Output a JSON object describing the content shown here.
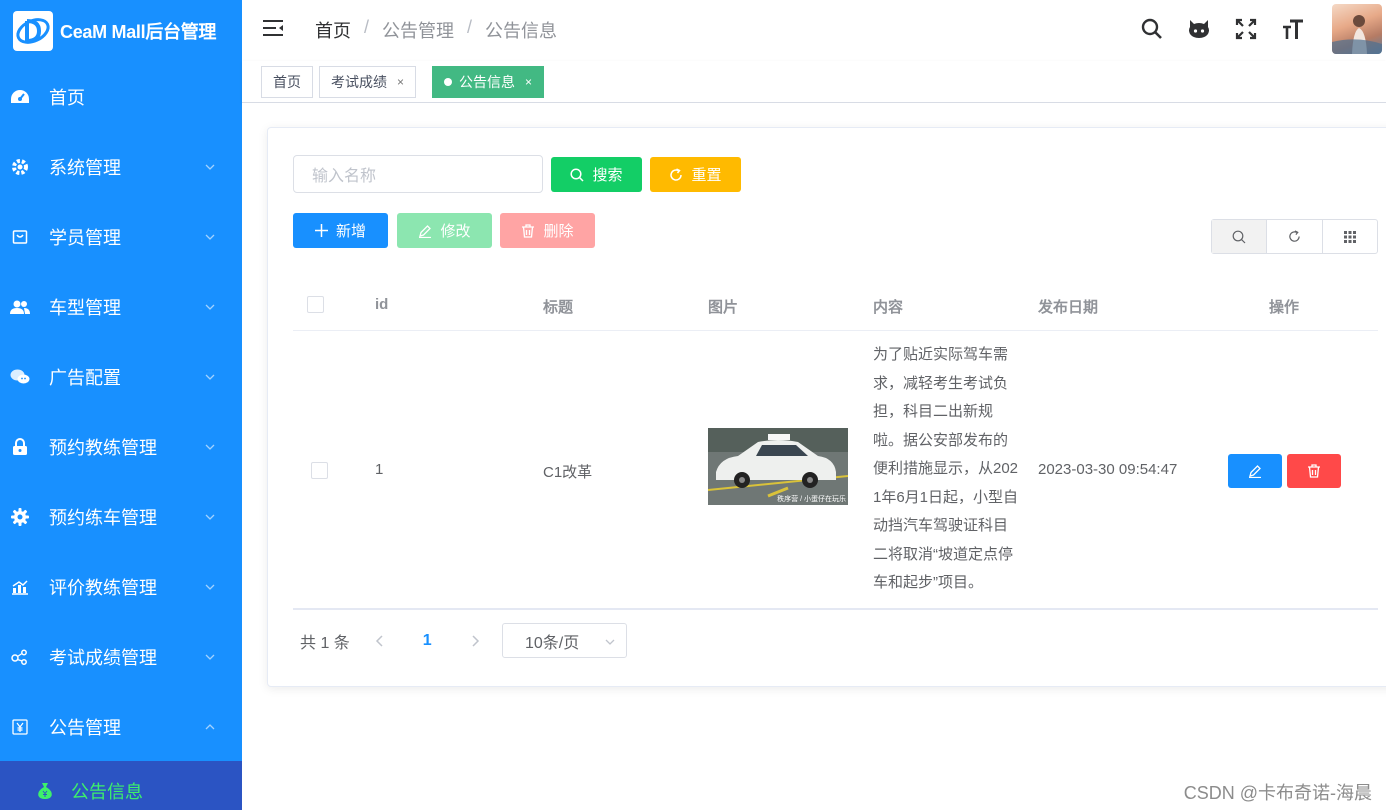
{
  "app": {
    "title": "CeaM Mall后台管理"
  },
  "sidebar": {
    "items": [
      {
        "label": "首页",
        "icon": "dashboard-icon"
      },
      {
        "label": "系统管理",
        "icon": "gear-icon"
      },
      {
        "label": "学员管理",
        "icon": "shopping-icon"
      },
      {
        "label": "车型管理",
        "icon": "users-icon"
      },
      {
        "label": "广告配置",
        "icon": "wechat-icon"
      },
      {
        "label": "预约教练管理",
        "icon": "lock-icon"
      },
      {
        "label": "预约练车管理",
        "icon": "cog-icon"
      },
      {
        "label": "评价教练管理",
        "icon": "chart-icon"
      },
      {
        "label": "考试成绩管理",
        "icon": "share-icon"
      },
      {
        "label": "公告管理",
        "icon": "yen-icon"
      }
    ],
    "sub_active": {
      "label": "公告信息",
      "icon": "money-bag-icon"
    }
  },
  "header": {
    "breadcrumb": [
      "首页",
      "公告管理",
      "公告信息"
    ]
  },
  "tags": [
    {
      "label": "首页"
    },
    {
      "label": "考试成绩"
    },
    {
      "label": "公告信息"
    }
  ],
  "tag_close": "×",
  "search": {
    "placeholder": "输入名称",
    "search_label": "搜索",
    "reset_label": "重置"
  },
  "actions": {
    "add": "新增",
    "edit": "修改",
    "delete": "删除"
  },
  "table": {
    "columns": [
      "id",
      "标题",
      "图片",
      "内容",
      "发布日期",
      "操作"
    ],
    "rows": [
      {
        "id": "1",
        "title": "C1改革",
        "image_caption": "秩序营 / 小蛋仔在玩乐",
        "content": "为了贴近实际驾车需求，减轻考生考试负担，科目二出新规啦。据公安部发布的便利措施显示，从2021年6月1日起，小型自动挡汽车驾驶证科目二将取消“坡道定点停车和起步”项目。",
        "date": "2023-03-30 09:54:47"
      }
    ]
  },
  "pagination": {
    "total_text": "共 1 条",
    "current": "1",
    "page_size": "10条/页"
  },
  "watermark": "CSDN @卡布奇诺-海晨",
  "colors": {
    "sidebar": "#1890ff",
    "primary": "#1890ff",
    "success": "#13ce66",
    "warning": "#ffba00",
    "danger": "#ff4949",
    "active_tag": "#42b983",
    "submenu_bg": "#2b54c3",
    "submenu_text": "#3df06b"
  }
}
